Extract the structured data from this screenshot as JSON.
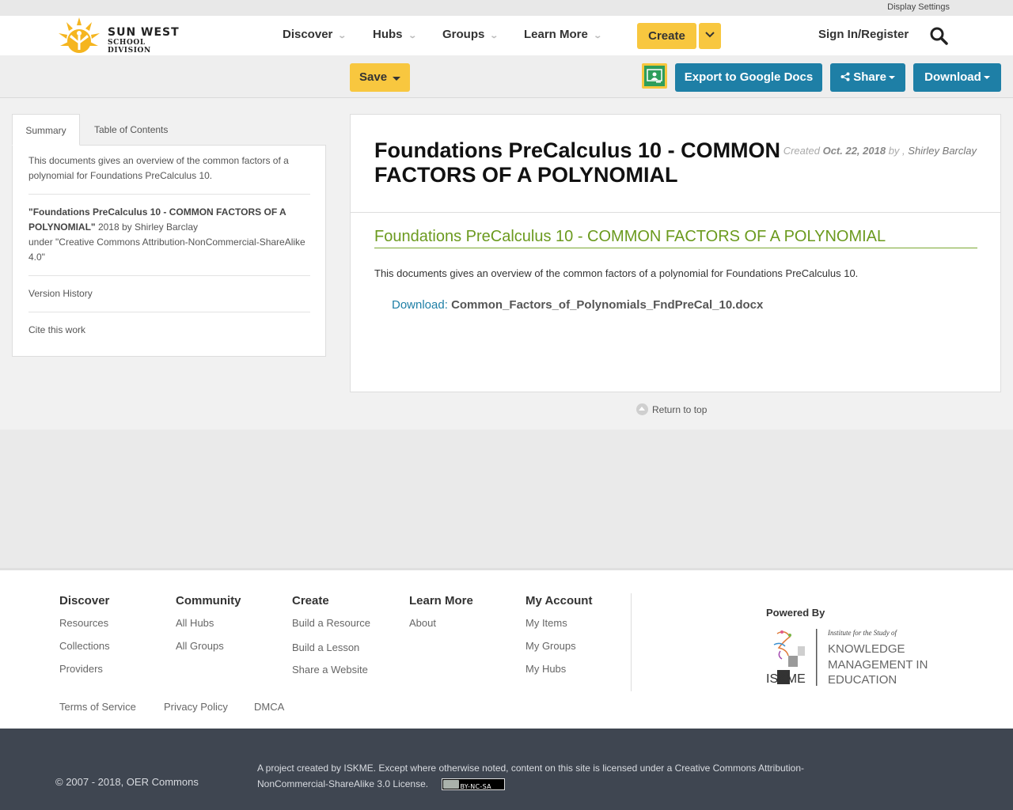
{
  "utility": {
    "display_settings": "Display Settings"
  },
  "brand": {
    "line1": "SUN WEST",
    "line2": "SCHOOL DIVISION"
  },
  "nav": {
    "discover": "Discover",
    "hubs": "Hubs",
    "groups": "Groups",
    "learn_more": "Learn More",
    "create": "Create",
    "sign_in": "Sign In/Register"
  },
  "toolbar": {
    "save": "Save",
    "export": "Export to Google Docs",
    "share": "Share",
    "download": "Download"
  },
  "side": {
    "tabs": [
      "Summary",
      "Table of Contents"
    ],
    "summary": "This documents gives an overview of the common factors of a polynomial for Foundations PreCalculus 10.",
    "citation_title": "\"Foundations PreCalculus 10 - COMMON FACTORS OF A POLYNOMIAL\"",
    "citation_rest": "2018 by Shirley Barclay",
    "license": "under \"Creative Commons Attribution-NonCommercial-ShareAlike 4.0\"",
    "version_history": "Version History",
    "cite": "Cite this work"
  },
  "resource": {
    "title": "Foundations PreCalculus 10 - COMMON FACTORS OF A POLYNOMIAL",
    "created_label": "Created",
    "created_date": "Oct. 22, 2018",
    "by": "by ,",
    "author": "Shirley Barclay",
    "subtitle": "Foundations PreCalculus 10 - COMMON FACTORS OF A POLYNOMIAL",
    "description": "This documents gives an overview of the common factors of a polynomial for Foundations PreCalculus 10.",
    "download_label": "Download:",
    "file_name": "Common_Factors_of_Polynomials_FndPreCal_10.docx"
  },
  "return_top": "Return to top",
  "footer": {
    "discover": {
      "heading": "Discover",
      "links": [
        "Resources",
        "Collections",
        "Providers"
      ]
    },
    "community": {
      "heading": "Community",
      "links": [
        "All Hubs",
        "All Groups"
      ]
    },
    "create": {
      "heading": "Create",
      "links": [
        "Build a Resource",
        "Build a Lesson",
        "Share a Website"
      ]
    },
    "learn_more": {
      "heading": "Learn More",
      "links": [
        "About"
      ]
    },
    "my_account": {
      "heading": "My Account",
      "links": [
        "My Items",
        "My Groups",
        "My Hubs"
      ]
    },
    "powered_by": "Powered By",
    "iskme": {
      "line1": "Institute for the Study of",
      "line2": "KNOWLEDGE",
      "line3": "MANAGEMENT IN",
      "line4": "EDUCATION",
      "mark": "ISKME"
    },
    "legal": [
      "Terms of Service",
      "Privacy Policy",
      "DMCA"
    ]
  },
  "bottom": {
    "copyright": "© 2007 - 2018, OER Commons",
    "project": "A project created by ISKME. Except where otherwise noted, content on this site is licensed under a Creative Commons Attribution-NonCommercial-ShareAlike 3.0 License.",
    "cc_badge": "BY-NC-SA"
  },
  "colors": {
    "accent_yellow": "#f8c73f",
    "button_blue": "#1e7fa6",
    "subtitle_green": "#6b9a1e",
    "footer_dark": "#3f4651"
  }
}
